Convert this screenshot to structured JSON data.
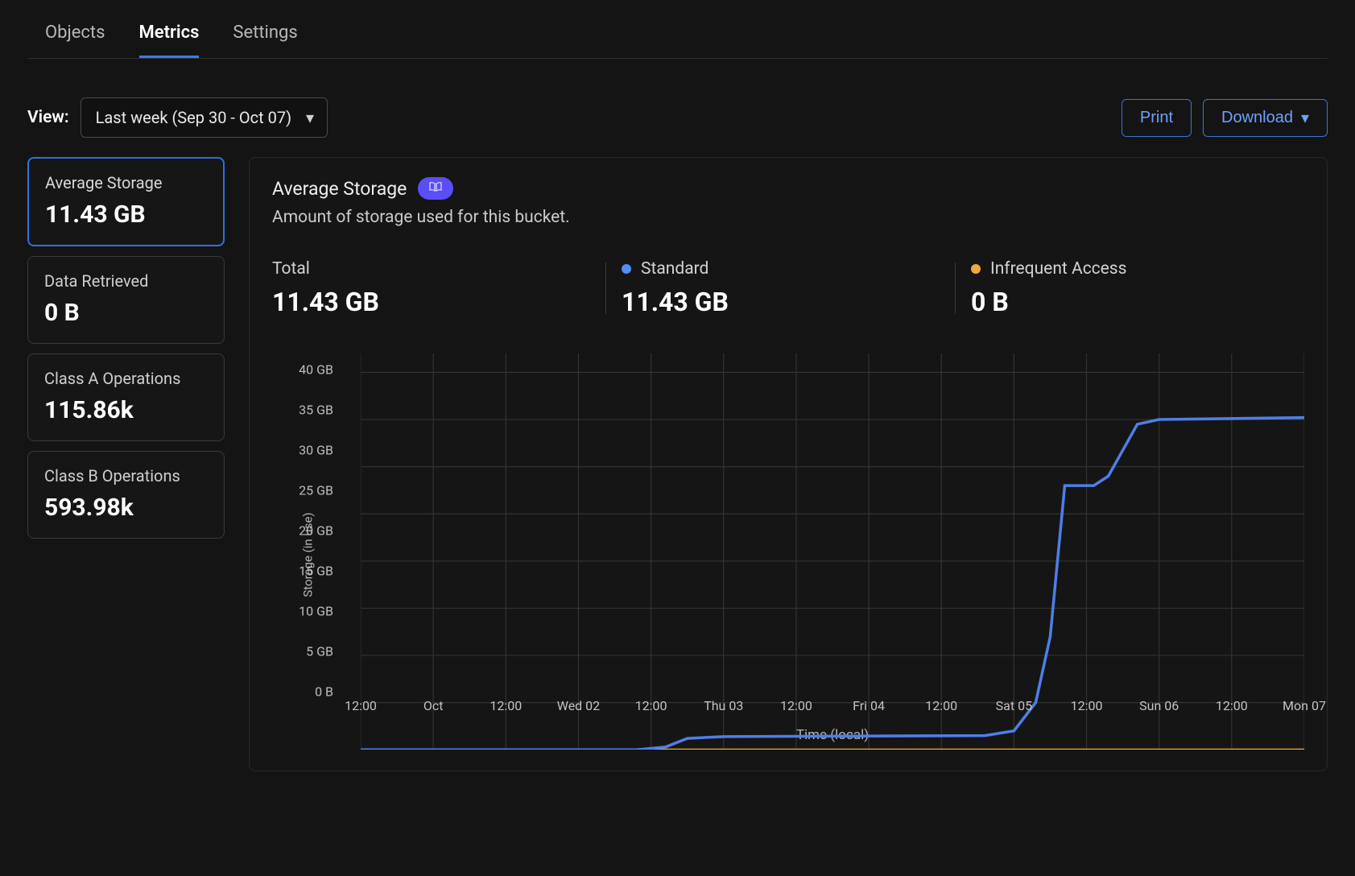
{
  "tabs": [
    {
      "label": "Objects",
      "active": false
    },
    {
      "label": "Metrics",
      "active": true
    },
    {
      "label": "Settings",
      "active": false
    }
  ],
  "toolbar": {
    "view_label": "View:",
    "view_value": "Last week (Sep 30 - Oct 07)",
    "print_label": "Print",
    "download_label": "Download"
  },
  "sidebar": {
    "items": [
      {
        "label": "Average Storage",
        "value": "11.43 GB",
        "selected": true
      },
      {
        "label": "Data Retrieved",
        "value": "0 B",
        "selected": false
      },
      {
        "label": "Class A Operations",
        "value": "115.86k",
        "selected": false
      },
      {
        "label": "Class B Operations",
        "value": "593.98k",
        "selected": false
      }
    ]
  },
  "panel": {
    "title": "Average Storage",
    "docs_icon": "docs",
    "description": "Amount of storage used for this bucket.",
    "stats": [
      {
        "label": "Total",
        "value": "11.43 GB",
        "dot": null
      },
      {
        "label": "Standard",
        "value": "11.43 GB",
        "dot": "blue"
      },
      {
        "label": "Infrequent Access",
        "value": "0 B",
        "dot": "orange"
      }
    ]
  },
  "chart_data": {
    "type": "line",
    "title": "Average Storage",
    "ylabel": "Storage (in use)",
    "xlabel": "Time (local)",
    "ylim_gb": [
      0,
      42
    ],
    "y_ticks": [
      "0 B",
      "5 GB",
      "10 GB",
      "15 GB",
      "20 GB",
      "25 GB",
      "30 GB",
      "35 GB",
      "40 GB"
    ],
    "y_tick_values_gb": [
      0,
      5,
      10,
      15,
      20,
      25,
      30,
      35,
      40
    ],
    "x_ticks": [
      "12:00",
      "Oct",
      "12:00",
      "Wed 02",
      "12:00",
      "Thu 03",
      "12:00",
      "Fri 04",
      "12:00",
      "Sat 05",
      "12:00",
      "Sun 06",
      "12:00",
      "Mon 07"
    ],
    "x_tick_positions": [
      0,
      1,
      2,
      3,
      4,
      5,
      6,
      7,
      8,
      9,
      10,
      11,
      12,
      13
    ],
    "x_range": [
      0,
      13
    ],
    "series": [
      {
        "name": "Standard",
        "color": "#4f7ee8",
        "points": [
          {
            "x": 0,
            "y_gb": 0
          },
          {
            "x": 3.8,
            "y_gb": 0
          },
          {
            "x": 4.2,
            "y_gb": 0.3
          },
          {
            "x": 4.5,
            "y_gb": 1.2
          },
          {
            "x": 5.0,
            "y_gb": 1.4
          },
          {
            "x": 8.6,
            "y_gb": 1.5
          },
          {
            "x": 9.0,
            "y_gb": 2.0
          },
          {
            "x": 9.3,
            "y_gb": 5.0
          },
          {
            "x": 9.5,
            "y_gb": 12.0
          },
          {
            "x": 9.7,
            "y_gb": 28.0
          },
          {
            "x": 10.1,
            "y_gb": 28.0
          },
          {
            "x": 10.3,
            "y_gb": 29.0
          },
          {
            "x": 10.7,
            "y_gb": 34.5
          },
          {
            "x": 11.0,
            "y_gb": 35.0
          },
          {
            "x": 13.0,
            "y_gb": 35.2
          }
        ]
      },
      {
        "name": "Infrequent Access",
        "color": "#f2a83c",
        "points": [
          {
            "x": 0,
            "y_gb": 0
          },
          {
            "x": 13,
            "y_gb": 0
          }
        ]
      }
    ]
  }
}
